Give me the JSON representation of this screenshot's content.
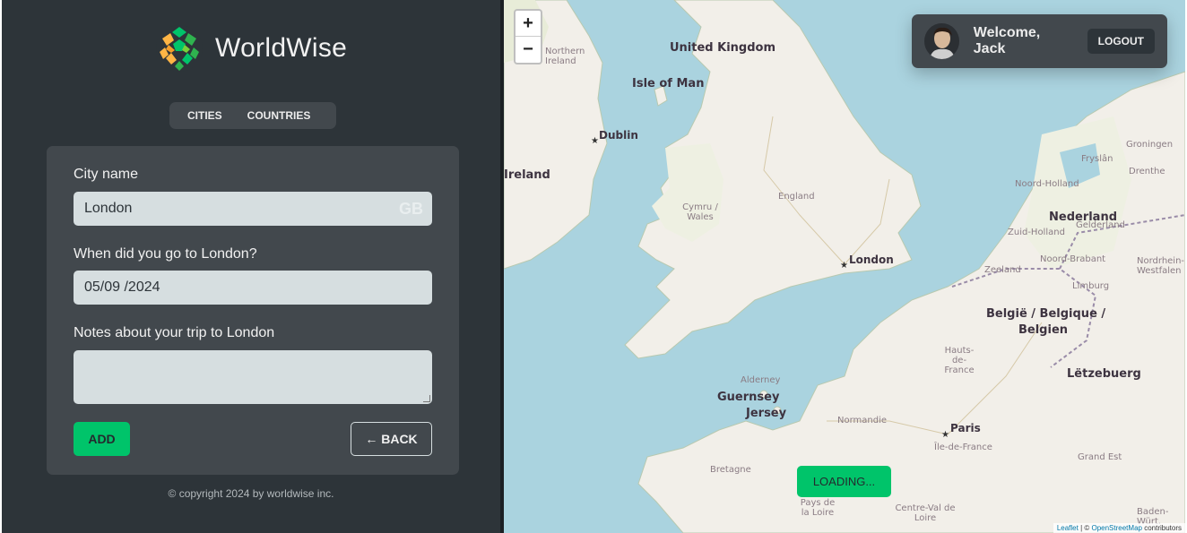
{
  "app": {
    "name": "WorldWise",
    "copyright": "© copyright 2024 by worldwise inc."
  },
  "tabs": [
    {
      "label": "Cities"
    },
    {
      "label": "Countries"
    }
  ],
  "form": {
    "city_label": "City name",
    "city_value": "London",
    "country_code": "GB",
    "date_label": "When did you go to London?",
    "date_value": "05/09 /2024",
    "notes_label": "Notes about your trip to London",
    "notes_value": "",
    "add_label": "ADD",
    "back_label": "← BACK"
  },
  "map": {
    "zoom_in": "+",
    "zoom_out": "−",
    "loading": "LOADING...",
    "attribution_leaflet": "Leaflet",
    "attribution_sep": " | © ",
    "attribution_osm": "OpenStreetMap",
    "attribution_tail": " contributors",
    "labels": {
      "uk": "United Kingdom",
      "northern_ireland": "Northern Ireland",
      "isle_of_man": "Isle of Man",
      "dublin": "Dublin",
      "ireland": "Ireland",
      "england": "England",
      "wales": "Cymru / Wales",
      "london": "London",
      "nederland": "Nederland",
      "noord_holland": "Noord-Holland",
      "zuid_holland": "Zuid-Holland",
      "gelderland": "Gelderland",
      "friesland": "Fryslân",
      "groningen": "Groningen",
      "drenthe": "Drenthe",
      "zeeland": "Zeeland",
      "noord_brabant": "Noord-Brabant",
      "limburg": "Limburg",
      "nordrhein": "Nordrhein-Westfalen",
      "belgie": "België / Belgique /",
      "belgien": "Belgien",
      "letzebuerg": "Lëtzebuerg",
      "hauts_de_france": "Hauts-de-France",
      "paris": "Paris",
      "ile_de_france": "Île-de-France",
      "grand_est": "Grand Est",
      "normandie": "Normandie",
      "bretagne": "Bretagne",
      "pays_de_la_loire": "Pays de la Loire",
      "centre_val_de_loire": "Centre-Val de Loire",
      "guernsey": "Guernsey",
      "jersey": "Jersey",
      "alderney": "Alderney",
      "baden": "Baden-Würt."
    }
  },
  "user": {
    "welcome": "Welcome, Jack",
    "logout": "LOGOUT"
  },
  "colors": {
    "sidebar_bg": "#2d3439",
    "card_bg": "#42484d",
    "brand_green": "#00c46a",
    "input_bg": "#d6dee0",
    "sea": "#aad3df",
    "land": "#f2efe9"
  }
}
